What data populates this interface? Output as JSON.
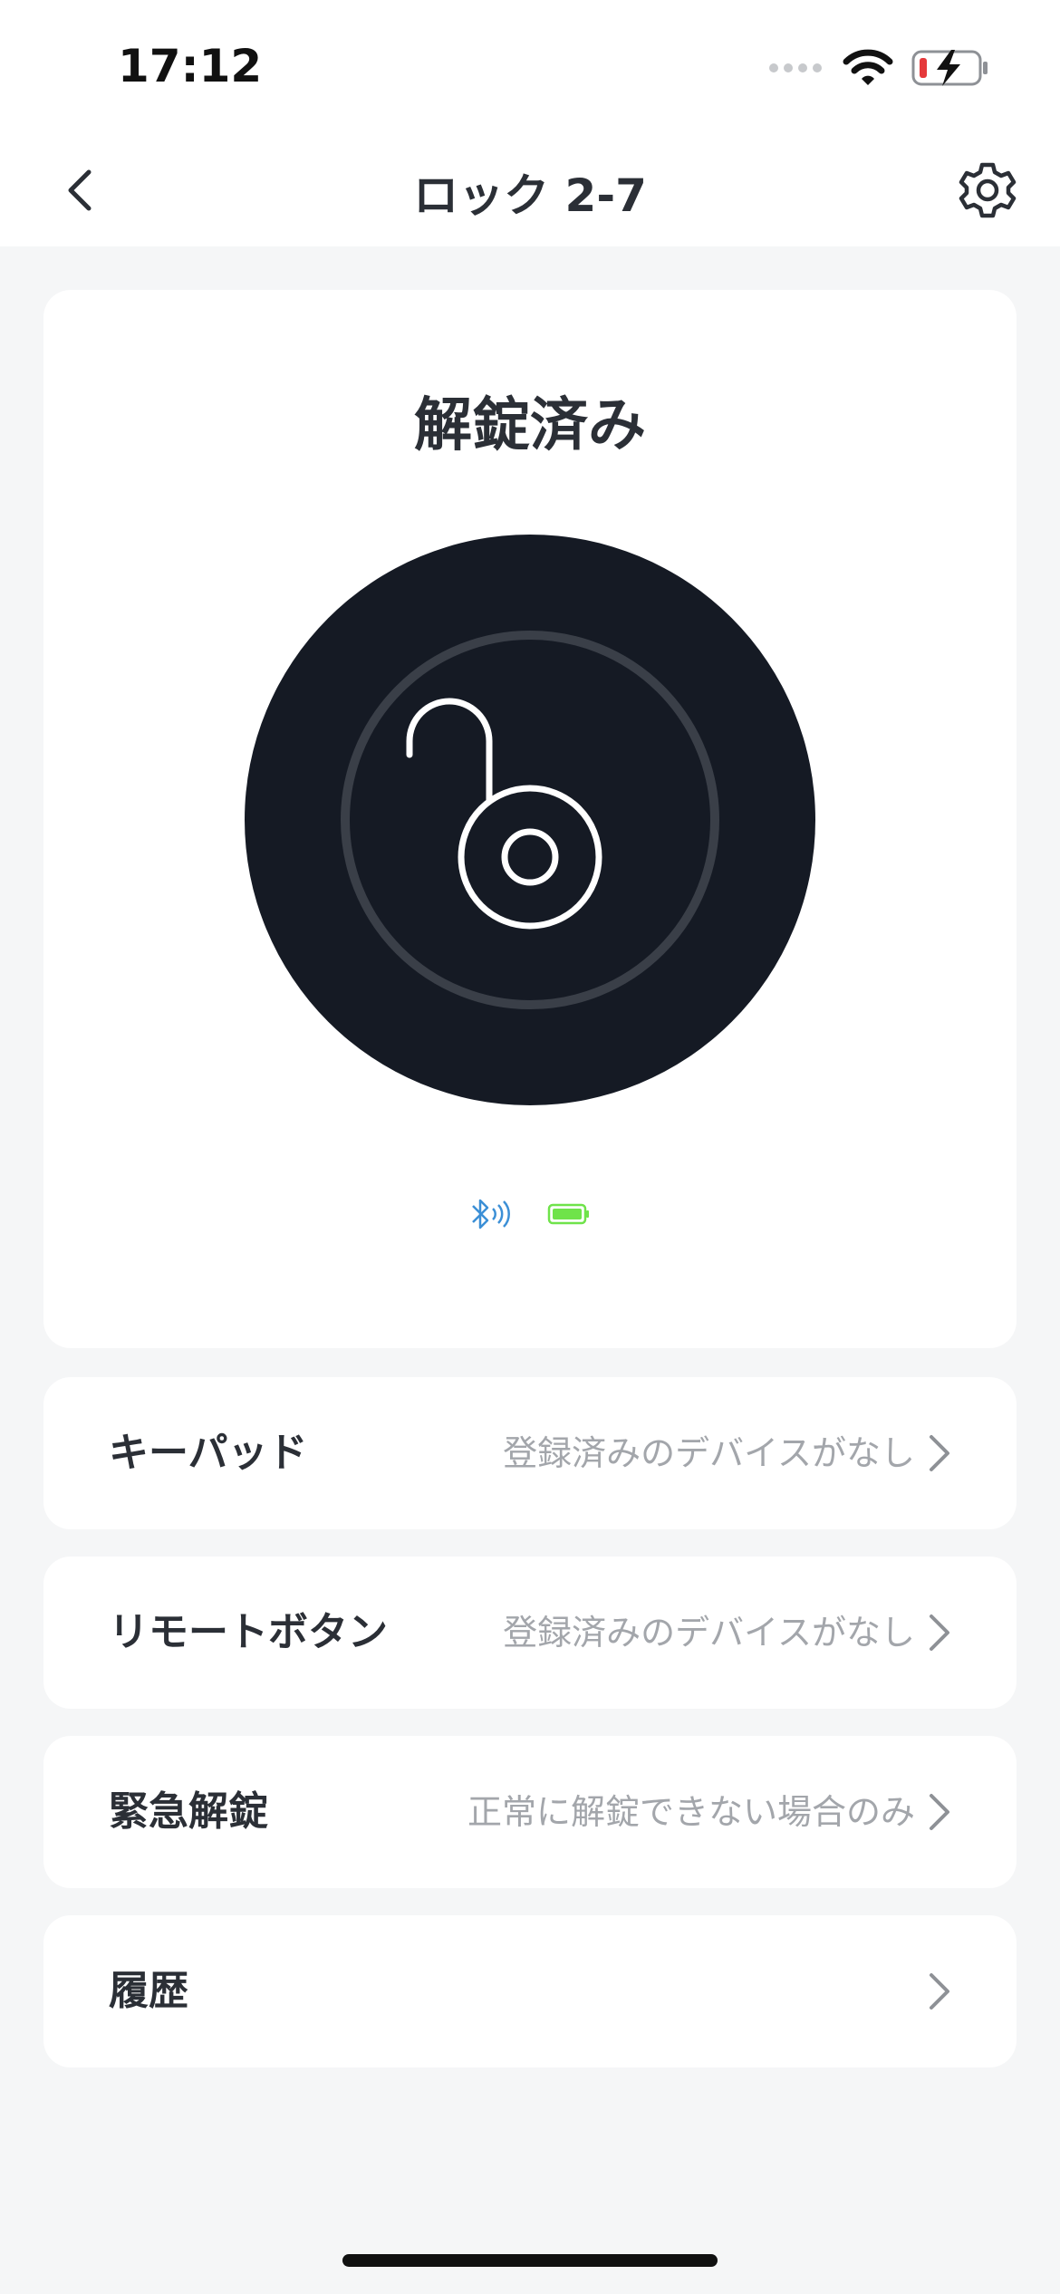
{
  "status_bar": {
    "time": "17:12",
    "battery_color": "#e5393b"
  },
  "nav": {
    "title": "ロック 2-7",
    "back_icon": "chevron-left-icon",
    "settings_icon": "gear-icon"
  },
  "lock": {
    "status_text": "解錠済み",
    "icon": "unlocked-padlock-icon",
    "button_color": "#151a24",
    "ring_color": "#3a3f48",
    "bluetooth_color": "#3b8fd6",
    "device_battery_color": "#6fe34a"
  },
  "menu": [
    {
      "label": "キーパッド",
      "value": "登録済みのデバイスがなし"
    },
    {
      "label": "リモートボタン",
      "value": "登録済みのデバイスがなし"
    },
    {
      "label": "緊急解錠",
      "value": "正常に解錠できない場合のみ"
    },
    {
      "label": "履歴",
      "value": ""
    }
  ]
}
